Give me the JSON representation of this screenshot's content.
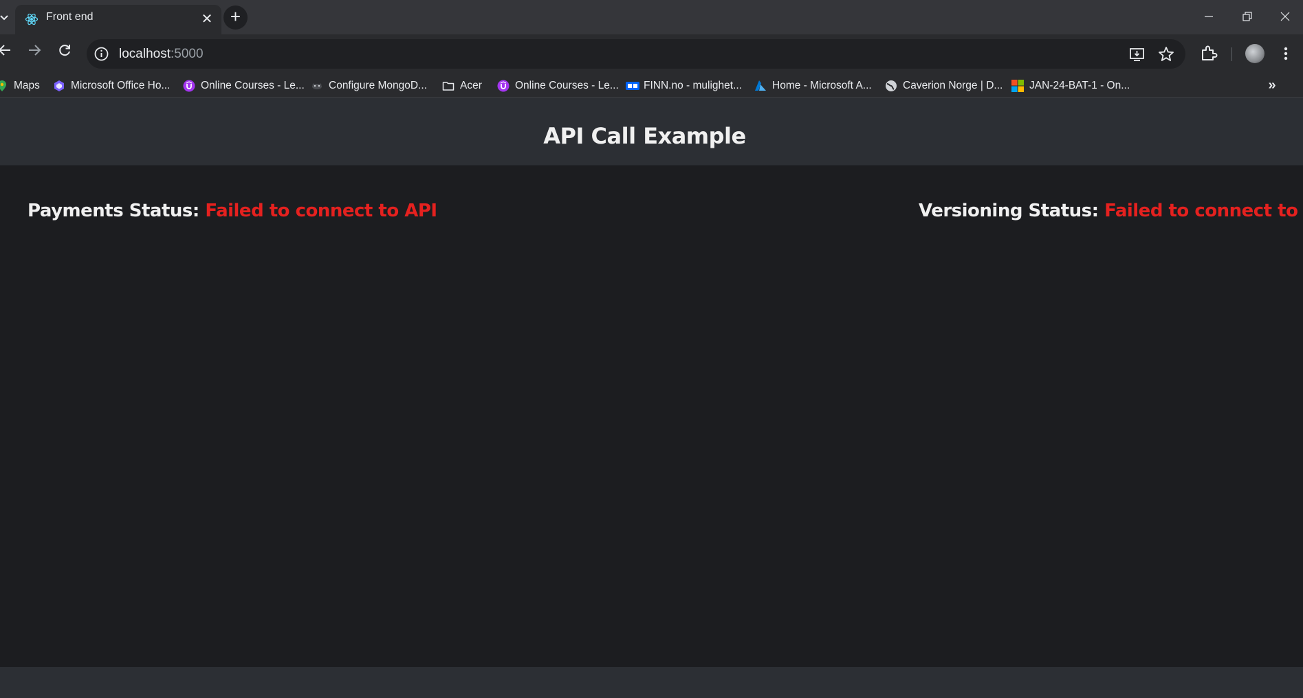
{
  "browser": {
    "tab": {
      "title": "Front end",
      "close_symbol": "✕"
    },
    "new_tab_symbol": "+",
    "window_controls": {
      "minimize": "—",
      "restore": "❐",
      "close": "✕"
    },
    "address_bar": {
      "host": "localhost",
      "port": ":5000"
    },
    "bookmarks": [
      {
        "label": "Maps",
        "icon": "maps-icon"
      },
      {
        "label": "Microsoft Office Ho...",
        "icon": "office-icon"
      },
      {
        "label": "Online Courses - Le...",
        "icon": "udemy-icon"
      },
      {
        "label": "Configure MongoD...",
        "icon": "github-icon"
      },
      {
        "label": "Acer",
        "icon": "folder-icon"
      },
      {
        "label": "Online Courses - Le...",
        "icon": "udemy-icon"
      },
      {
        "label": "FINN.no - mulighet...",
        "icon": "finn-icon"
      },
      {
        "label": "Home - Microsoft A...",
        "icon": "azure-icon"
      },
      {
        "label": "Caverion Norge | D...",
        "icon": "globe-icon"
      },
      {
        "label": "JAN-24-BAT-1 - On...",
        "icon": "microsoft-icon"
      }
    ],
    "bookmarks_more": "»"
  },
  "page": {
    "title": "API Call Example",
    "payments": {
      "label": "Payments Status:",
      "value": "Failed to connect to API"
    },
    "versioning": {
      "label": "Versioning Status:",
      "value": "Failed to connect to API"
    },
    "side_widget": "›‹"
  },
  "colors": {
    "error": "#e5211f",
    "header_bg": "#2c2f34",
    "main_bg": "#1c1d20"
  }
}
